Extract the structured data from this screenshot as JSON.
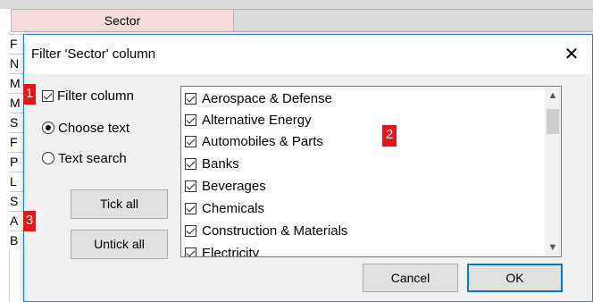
{
  "sheet": {
    "column_header": "Sector",
    "row_stubs": [
      "F",
      "N",
      "M",
      "M",
      "S",
      "F",
      "P",
      "L",
      "S",
      "A",
      "B"
    ]
  },
  "dialog": {
    "title": "Filter 'Sector' column",
    "close_glyph": "✕",
    "filter_column_label": "Filter column",
    "filter_column_checked": true,
    "mode_options": [
      {
        "label": "Choose text",
        "selected": true
      },
      {
        "label": "Text search",
        "selected": false
      }
    ],
    "tick_all_label": "Tick all",
    "untick_all_label": "Untick all",
    "list_items": [
      {
        "label": "Aerospace & Defense",
        "checked": true
      },
      {
        "label": "Alternative Energy",
        "checked": true
      },
      {
        "label": "Automobiles & Parts",
        "checked": true
      },
      {
        "label": "Banks",
        "checked": true
      },
      {
        "label": "Beverages",
        "checked": true
      },
      {
        "label": "Chemicals",
        "checked": true
      },
      {
        "label": "Construction & Materials",
        "checked": true
      },
      {
        "label": "Electricity",
        "checked": true
      }
    ],
    "cancel_label": "Cancel",
    "ok_label": "OK"
  },
  "badges": [
    "1",
    "2",
    "3"
  ],
  "colors": {
    "dialog_border": "#1883d7",
    "badge": "#e8141a",
    "header_highlight": "#f6dcdc"
  }
}
